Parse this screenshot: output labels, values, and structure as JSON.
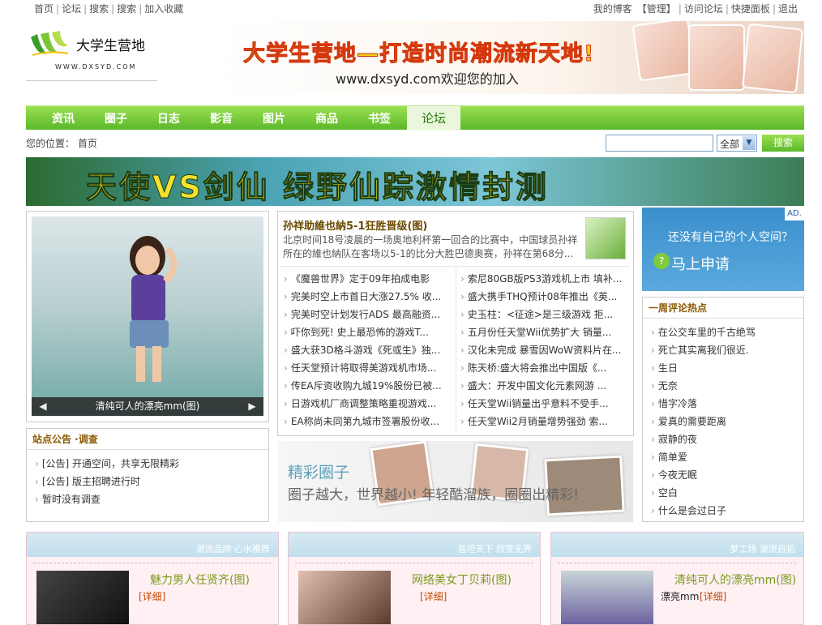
{
  "topbar": {
    "left_links": [
      "首页",
      "论坛",
      "搜索",
      "搜索",
      "加入收藏"
    ],
    "right_links": [
      "我的博客",
      "【管理】",
      "访问论坛",
      "快捷面板",
      "退出"
    ]
  },
  "logo": {
    "name": "大学生营地",
    "sub": "WWW.DXSYD.COM"
  },
  "top_banner": {
    "line1": "大学生营地—打造时尚潮流新天地!",
    "line2": "www.dxsyd.com欢迎您的加入"
  },
  "nav": {
    "items": [
      "资讯",
      "圈子",
      "日志",
      "影音",
      "图片",
      "商品",
      "书签"
    ],
    "active": "论坛"
  },
  "location": {
    "label": "您的位置：",
    "value": "首页"
  },
  "search": {
    "placeholder": "",
    "scope": "全部",
    "button": "搜索"
  },
  "game_banner": {
    "text": "天使VS剑仙 绿野仙踪激情封测"
  },
  "photo": {
    "caption": "清纯可人的漂亮mm(图)",
    "prev": "◀",
    "next": "▶"
  },
  "headline": {
    "title": "孙祥助維也納5-1狂胜晋级(图)",
    "summary": "北京时间18号凌晨的一场奥地利杯第一回合的比赛中，中国球员孙祥所在的維也納队在客场以5-1的比分大胜巴德奥赛，孙祥在第68分..."
  },
  "news_left": [
    "《魔兽世界》定于09年拍成电影",
    "完美时空上市首日大涨27.5% 收...",
    "完美时空计划发行ADS 最高融资...",
    "吓你到死! 史上最恐怖的游戏T...",
    "盛大获3D格斗游戏《死或生》独...",
    "任天堂预计将取得美游戏机市场...",
    "传EA斥资收购九城19%股份已被...",
    "日游戏机厂商调整策略重视游戏...",
    "EA称尚未同第九城市签署股份收..."
  ],
  "news_right": [
    "索尼80GB版PS3游戏机上市 填补...",
    "盛大携手THQ预计08年推出《英...",
    "史玉柱：<征途>是三级游戏 拒...",
    "五月份任天堂Wii优势扩大 销量...",
    "汉化未完成 暴雪因WoW资料片在...",
    "陈天桥:盛大将会推出中国版《...",
    "盛大：开发中国文化元素网游 ...",
    "任天堂Wii销量出乎意料不受手...",
    "任天堂Wii2月销量增势强劲 索..."
  ],
  "announce": {
    "title": "站点公告 ·调查",
    "items": [
      "[公告] 开通空间，共享无限精彩",
      "[公告] 版主招聘进行时",
      "暂时没有调查"
    ]
  },
  "circle_banner": {
    "title": "精彩圈子",
    "slogan": "圈子越大，世界越小! 年轻酷溜族，圈圈出精彩!"
  },
  "space_ad": {
    "ad": "AD.",
    "line1": "还没有自己的个人空间？",
    "line2": "马上申请",
    "icon": "?"
  },
  "hot": {
    "title": "一周评论热点",
    "items": [
      "在公交车里的千古绝骂",
      "死亡其实离我们很近.",
      "生日",
      "无奈",
      "惜字冷落",
      "爱真的需要距离",
      "寂静的夜",
      "简单爱",
      "今夜无眠",
      "空白",
      "什么是会过日子"
    ]
  },
  "cards": [
    {
      "tag": "潮流品牌 心水推荐",
      "title": "魅力男人任贤齐(图)",
      "link": "[详细]",
      "extra": ""
    },
    {
      "tag": "音坦天下 欣赏无界",
      "title": "网络美女丁贝莉(图)",
      "link": "[详细]",
      "extra": ""
    },
    {
      "tag": "梦工场 潮流自拍",
      "title": "清纯可人的漂亮mm(图)",
      "link": "[详细]",
      "extra": "漂亮mm"
    }
  ]
}
